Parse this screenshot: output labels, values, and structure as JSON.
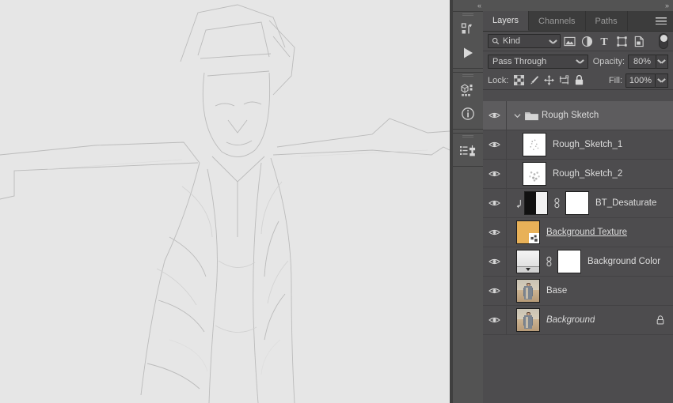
{
  "app": {
    "canvas": {
      "artwork_description": "faint pencil sketch of a person, arms outstretched",
      "background_color": "#e6e6e6"
    }
  },
  "icon_rail": {
    "collapse_label": "«",
    "buttons": [
      {
        "name": "actions-icon",
        "title": "Actions"
      },
      {
        "name": "play-icon",
        "title": "Play"
      },
      {
        "name": "libraries-icon",
        "title": "Libraries"
      },
      {
        "name": "info-icon",
        "title": "Info"
      },
      {
        "name": "clone-source-icon",
        "title": "Clone Source"
      }
    ]
  },
  "panel": {
    "collapse_label": "»",
    "tabs": [
      {
        "label": "Layers",
        "active": true
      },
      {
        "label": "Channels",
        "active": false
      },
      {
        "label": "Paths",
        "active": false
      }
    ],
    "menu_label": "Panel Menu",
    "filter": {
      "kind_label": "Kind",
      "icons": [
        "pixel-filter-icon",
        "adjustment-filter-icon",
        "type-filter-icon",
        "shape-filter-icon",
        "smart-object-filter-icon"
      ],
      "toggle_name": "filter-enable-toggle"
    },
    "blend": {
      "mode": "Pass Through",
      "opacity_label": "Opacity:",
      "opacity_value": "80%"
    },
    "lock": {
      "label": "Lock:",
      "icons": [
        "lock-transparent-pixels-icon",
        "lock-image-pixels-icon",
        "lock-position-icon",
        "lock-artboard-nesting-icon",
        "lock-all-icon"
      ],
      "fill_label": "Fill:",
      "fill_value": "100%"
    },
    "layers": [
      {
        "name": "Rough Sketch",
        "type": "group",
        "selected": true,
        "visible": true,
        "expanded": true,
        "thumb": "folder",
        "italic": false,
        "underline": false,
        "locked": false
      },
      {
        "name": "Rough_Sketch_1",
        "type": "pixel",
        "selected": false,
        "visible": true,
        "thumb": "sketch1",
        "italic": false,
        "underline": false,
        "locked": false
      },
      {
        "name": "Rough_Sketch_2",
        "type": "pixel",
        "selected": false,
        "visible": true,
        "thumb": "sketch2",
        "italic": false,
        "underline": false,
        "locked": false
      },
      {
        "name": "BT_Desaturate",
        "type": "adjustment",
        "selected": false,
        "visible": true,
        "clipped": true,
        "thumb": "bw",
        "linked": true,
        "mask": true,
        "italic": false,
        "underline": false,
        "locked": false
      },
      {
        "name": "Background Texture ",
        "type": "smart-object",
        "selected": false,
        "visible": true,
        "thumb": "orange",
        "smart_object": true,
        "italic": false,
        "underline": true,
        "locked": false
      },
      {
        "name": "Background Color",
        "type": "fill",
        "selected": false,
        "visible": true,
        "thumb": "gradient",
        "linked": true,
        "mask": true,
        "italic": false,
        "underline": false,
        "locked": false
      },
      {
        "name": "Base",
        "type": "pixel",
        "selected": false,
        "visible": true,
        "thumb": "photo",
        "italic": false,
        "underline": false,
        "locked": false
      },
      {
        "name": "Background",
        "type": "background",
        "selected": false,
        "visible": true,
        "thumb": "photo",
        "italic": true,
        "underline": false,
        "locked": true
      }
    ]
  },
  "colors": {
    "panel_bg": "#4d4c4e",
    "tab_bg": "#3c3c3c",
    "rail_bg": "#535353",
    "canvas_bg": "#e6e6e6",
    "row_selected": "#5d5c5e",
    "text": "#dcdcdc",
    "accent_orange": "#e8b158"
  }
}
